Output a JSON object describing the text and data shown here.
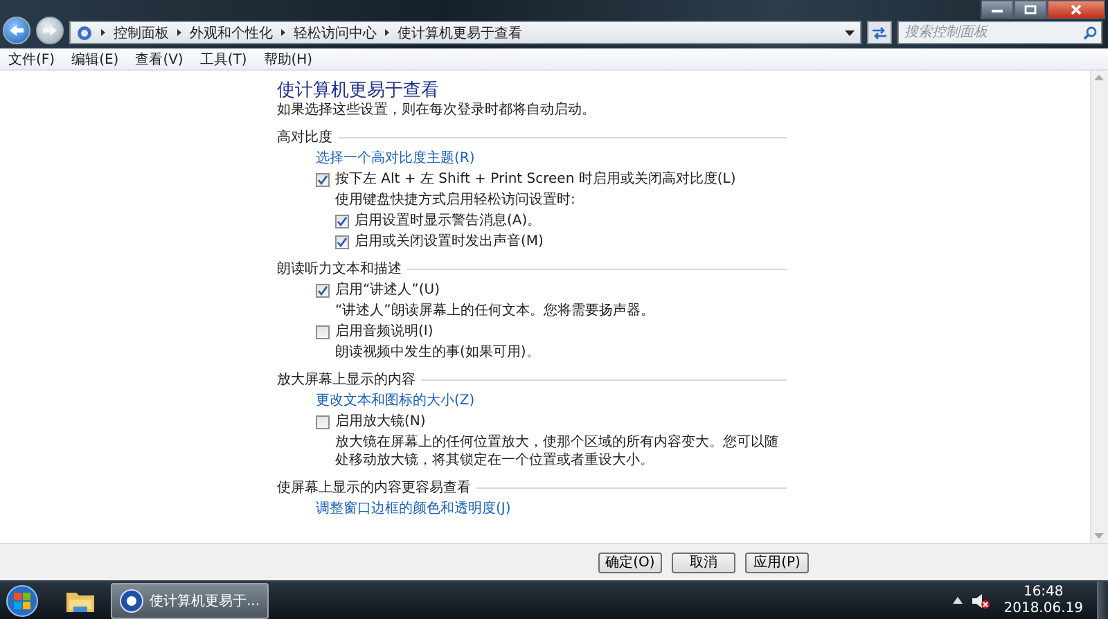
{
  "breadcrumb": [
    "控制面板",
    "外观和个性化",
    "轻松访问中心",
    "使计算机更易于查看"
  ],
  "search": {
    "placeholder": "搜索控制面板"
  },
  "menu": [
    "文件(F)",
    "编辑(E)",
    "查看(V)",
    "工具(T)",
    "帮助(H)"
  ],
  "page": {
    "title": "使计算机更易于查看",
    "subtitle": "如果选择这些设置，则在每次登录时都将自动启动。",
    "sections": [
      {
        "heading": "高对比度",
        "items": [
          {
            "kind": "link",
            "label": "选择一个高对比度主题(R)"
          },
          {
            "kind": "checkbox",
            "label": "按下左 Alt + 左 Shift + Print Screen 时启用或关闭高对比度(L)",
            "checked": true,
            "children": [
              {
                "kind": "text",
                "label": "使用键盘快捷方式启用轻松访问设置时:"
              },
              {
                "kind": "checkbox",
                "label": "启用设置时显示警告消息(A)。",
                "checked": true
              },
              {
                "kind": "checkbox",
                "label": "启用或关闭设置时发出声音(M)",
                "checked": true
              }
            ]
          }
        ]
      },
      {
        "heading": "朗读听力文本和描述",
        "items": [
          {
            "kind": "checkbox",
            "label": "启用“讲述人”(U)",
            "checked": true,
            "children": [
              {
                "kind": "text",
                "label": "“讲述人”朗读屏幕上的任何文本。您将需要扬声器。"
              }
            ]
          },
          {
            "kind": "checkbox",
            "label": "启用音频说明(I)",
            "checked": false,
            "children": [
              {
                "kind": "text",
                "label": "朗读视频中发生的事(如果可用)。"
              }
            ]
          }
        ]
      },
      {
        "heading": "放大屏幕上显示的内容",
        "items": [
          {
            "kind": "link",
            "label": "更改文本和图标的大小(Z)"
          },
          {
            "kind": "checkbox",
            "label": "启用放大镜(N)",
            "checked": false,
            "children": [
              {
                "kind": "text",
                "label": "放大镜在屏幕上的任何位置放大，使那个区域的所有内容变大。您可以随处移动放大镜，将其锁定在一个位置或者重设大小。"
              }
            ]
          }
        ]
      },
      {
        "heading": "使屏幕上显示的内容更容易查看",
        "items": [
          {
            "kind": "link",
            "label": "调整窗口边框的颜色和透明度(J)"
          }
        ]
      }
    ]
  },
  "buttons": [
    "确定(O)",
    "取消",
    "应用(P)"
  ],
  "taskbar": {
    "tasks": [
      {
        "label": "使计算机更易于...",
        "selected": true
      }
    ],
    "volume": {
      "muted": true
    },
    "clock": {
      "time": "16:48",
      "date": "2018.06.19"
    }
  }
}
